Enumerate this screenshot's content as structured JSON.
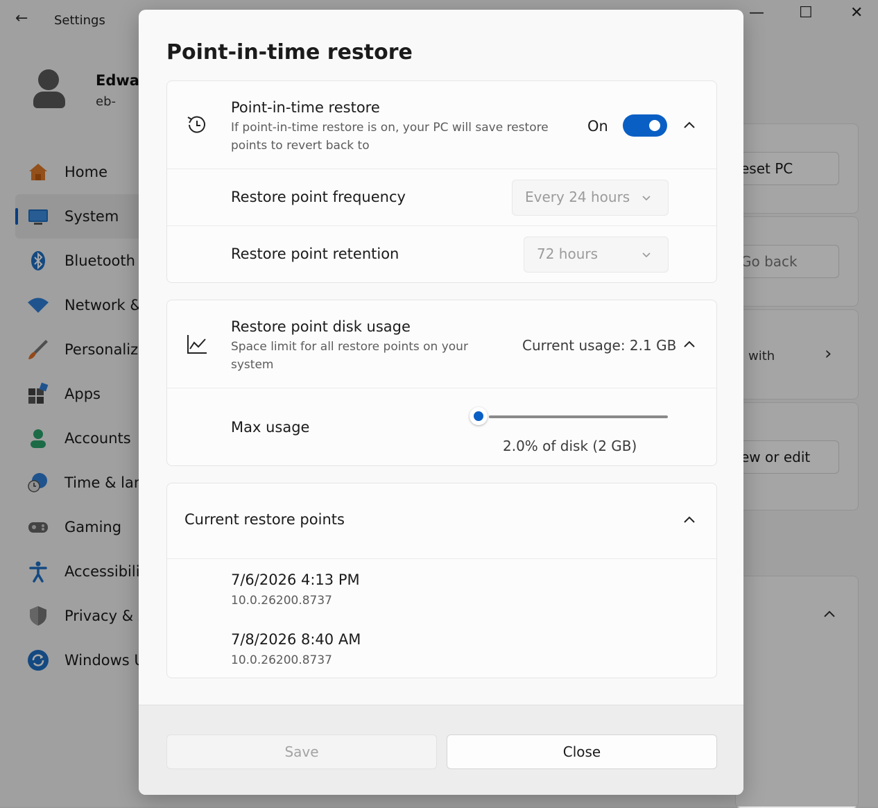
{
  "window": {
    "app_title": "Settings",
    "back_glyph": "←",
    "min_glyph": "—",
    "max_glyph": "☐",
    "close_glyph": "✕"
  },
  "profile": {
    "name": "Edwar",
    "email": "eb-"
  },
  "nav": {
    "items": [
      {
        "label": "Home",
        "icon": "home-icon"
      },
      {
        "label": "System",
        "icon": "system-icon",
        "active": true
      },
      {
        "label": "Bluetooth",
        "icon": "bluetooth-icon"
      },
      {
        "label": "Network &",
        "icon": "network-icon"
      },
      {
        "label": "Personaliza",
        "icon": "personalization-icon"
      },
      {
        "label": "Apps",
        "icon": "apps-icon"
      },
      {
        "label": "Accounts",
        "icon": "accounts-icon"
      },
      {
        "label": "Time & lan",
        "icon": "time-language-icon"
      },
      {
        "label": "Gaming",
        "icon": "gaming-icon"
      },
      {
        "label": "Accessibilit",
        "icon": "accessibility-icon"
      },
      {
        "label": "Privacy & s",
        "icon": "privacy-icon"
      },
      {
        "label": "Windows U",
        "icon": "windows-update-icon"
      }
    ]
  },
  "background_right": {
    "reset_pc": "eset PC",
    "go_back": "Go back",
    "with_text": "with",
    "view_edit": "ew or edit",
    "chevron_right": "›"
  },
  "dialog": {
    "title": "Point-in-time restore",
    "pitr": {
      "title": "Point-in-time restore",
      "description": "If point-in-time restore is on, your PC will save restore points to revert back to",
      "toggle_label": "On",
      "toggle_on": true
    },
    "frequency": {
      "label": "Restore point frequency",
      "value": "Every 24 hours"
    },
    "retention": {
      "label": "Restore point retention",
      "value": "72 hours"
    },
    "disk": {
      "title": "Restore point disk usage",
      "description": "Space limit for all restore points on your system",
      "current_usage": "Current usage: 2.1 GB"
    },
    "max_usage": {
      "label": "Max usage",
      "value_text": "2.0% of disk (2 GB)",
      "slider_fraction": 0
    },
    "restore_points": {
      "title": "Current restore points",
      "items": [
        {
          "date": "7/6/2026 4:13 PM",
          "version": "10.0.26200.8737"
        },
        {
          "date": "7/8/2026 8:40 AM",
          "version": "10.0.26200.8737"
        }
      ]
    },
    "footer": {
      "save_label": "Save",
      "close_label": "Close"
    }
  },
  "colors": {
    "accent": "#0a5fc4",
    "dialog_bg": "#f9f9f9",
    "overlay": "#000000"
  }
}
